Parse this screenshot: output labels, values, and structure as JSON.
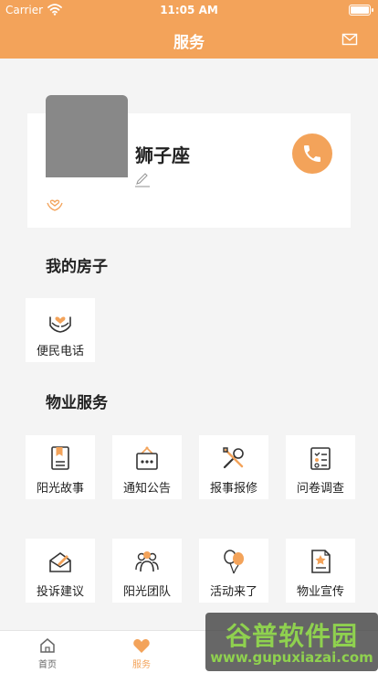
{
  "status_bar": {
    "carrier": "Carrier",
    "time": "11:05 AM"
  },
  "nav": {
    "title": "服务",
    "mail_icon": "envelope-icon"
  },
  "profile": {
    "name": "狮子座",
    "phone_icon": "phone-icon",
    "edit_icon": "pencil-icon",
    "badge_icon": "heart-hand-icon"
  },
  "sections": {
    "my_house": "我的房子",
    "property_service": "物业服务"
  },
  "my_house_items": [
    {
      "label": "便民电话",
      "icon": "helping-hands-icon"
    }
  ],
  "service_items": [
    {
      "label": "阳光故事",
      "icon": "bookmark-book-icon"
    },
    {
      "label": "通知公告",
      "icon": "notice-board-icon"
    },
    {
      "label": "报事报修",
      "icon": "tools-icon"
    },
    {
      "label": "问卷调查",
      "icon": "checklist-icon"
    },
    {
      "label": "投诉建议",
      "icon": "envelope-pen-icon"
    },
    {
      "label": "阳光团队",
      "icon": "team-icon"
    },
    {
      "label": "活动来了",
      "icon": "balloons-icon"
    },
    {
      "label": "物业宣传",
      "icon": "star-document-icon"
    }
  ],
  "tabbar": [
    {
      "label": "首页",
      "icon": "home-icon",
      "active": false
    },
    {
      "label": "服务",
      "icon": "heart-icon",
      "active": true
    }
  ],
  "watermark": {
    "main": "谷普软件园",
    "url": "www.gupuxiazai.com"
  },
  "colors": {
    "accent": "#f3a35a",
    "text": "#222222",
    "background": "#f4f4f4",
    "tab_inactive": "#666666"
  }
}
